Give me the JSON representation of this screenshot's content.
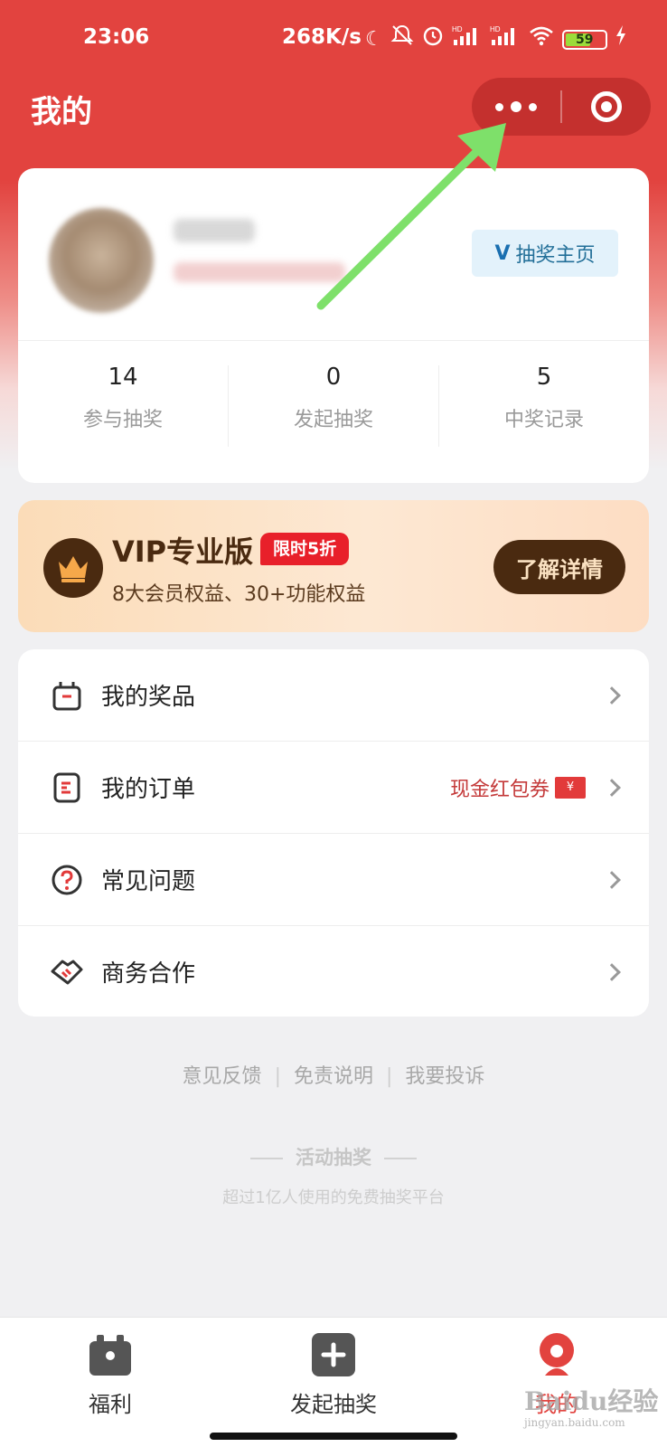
{
  "status_bar": {
    "time": "23:06",
    "network_speed": "268K/s",
    "battery": "59",
    "battery_level": 0.59,
    "icons": [
      "moon-icon",
      "mute-icon",
      "alarm-icon",
      "signal-hd-icon",
      "signal-hd-icon",
      "wifi-icon",
      "battery-icon",
      "charging-icon"
    ]
  },
  "header": {
    "title": "我的"
  },
  "profile": {
    "lottery_home_prefix": "V",
    "lottery_home_label": "抽奖主页",
    "stats": [
      {
        "value": "14",
        "label": "参与抽奖"
      },
      {
        "value": "0",
        "label": "发起抽奖"
      },
      {
        "value": "5",
        "label": "中奖记录"
      }
    ]
  },
  "vip": {
    "title": "VIP专业版",
    "badge": "限时5折",
    "subtitle": "8大会员权益、30+功能权益",
    "button": "了解详情"
  },
  "menu": {
    "items": [
      {
        "label": "我的奖品",
        "icon": "gift-box-icon"
      },
      {
        "label": "我的订单",
        "icon": "order-icon",
        "extra": "现金红包券",
        "extra_icon_text": "¥"
      },
      {
        "label": "常见问题",
        "icon": "question-icon"
      },
      {
        "label": "商务合作",
        "icon": "handshake-icon"
      }
    ]
  },
  "footer": {
    "links": [
      "意见反馈",
      "免责说明",
      "我要投诉"
    ],
    "brand": "活动抽奖",
    "brand_sub": "超过1亿人使用的免费抽奖平台"
  },
  "tabbar": {
    "tabs": [
      {
        "label": "福利",
        "icon": "gift-icon"
      },
      {
        "label": "发起抽奖",
        "icon": "plus-icon"
      },
      {
        "label": "我的",
        "icon": "user-icon",
        "active": true
      }
    ]
  },
  "watermark": {
    "text": "Baidu经验",
    "sub": "jingyan.baidu.com"
  },
  "colors": {
    "primary": "#e2433f",
    "vip_dark": "#4a2a10",
    "badge_red": "#e8202a",
    "annotation_arrow": "#7ee06a"
  }
}
